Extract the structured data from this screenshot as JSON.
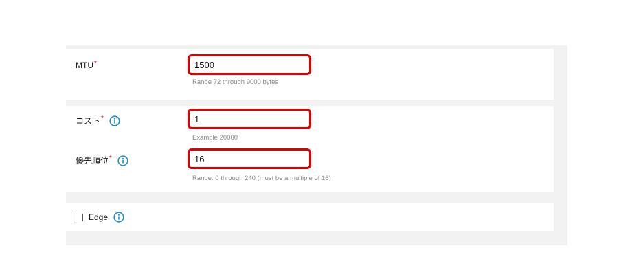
{
  "mtu": {
    "label": "MTU",
    "required_mark": "*",
    "value": "1500",
    "hint": "Range 72 through 9000 bytes"
  },
  "cost": {
    "label": "コスト",
    "required_mark": "*",
    "value": "1",
    "hint": "Example 20000",
    "info_icon": "info-icon"
  },
  "priority": {
    "label": "優先順位",
    "required_mark": "*",
    "value": "16",
    "hint": "Range: 0 through 240 (must be a multiple of 16)",
    "info_icon": "info-icon"
  },
  "edge": {
    "label": "Edge",
    "checked": false,
    "info_icon": "info-icon"
  },
  "colors": {
    "required": "#d9001b",
    "highlight_border": "#e00000",
    "info_icon": "#1a8fd1",
    "hint_text": "#888888"
  }
}
